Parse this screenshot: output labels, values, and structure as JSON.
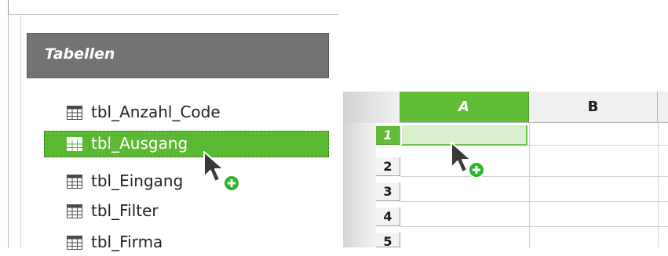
{
  "navigator": {
    "section_title": "Tabellen",
    "items": [
      {
        "label": "tbl_Anzahl_Code",
        "selected": false
      },
      {
        "label": "tbl_Ausgang",
        "selected": true
      },
      {
        "label": "tbl_Eingang",
        "selected": false
      },
      {
        "label": "tbl_Filter",
        "selected": false
      },
      {
        "label": "tbl_Firma",
        "selected": false
      }
    ]
  },
  "spreadsheet": {
    "columns": [
      "A",
      "B"
    ],
    "rows": [
      "1",
      "2",
      "3",
      "4",
      "5"
    ],
    "selected_column": "A",
    "selected_row": "1"
  },
  "colors": {
    "selection_green": "#5bb832",
    "header_gray": "#737373",
    "drop_badge_green": "#2fb52c"
  },
  "icons": {
    "table": "table-icon",
    "cursor": "drag-copy-cursor-icon"
  }
}
